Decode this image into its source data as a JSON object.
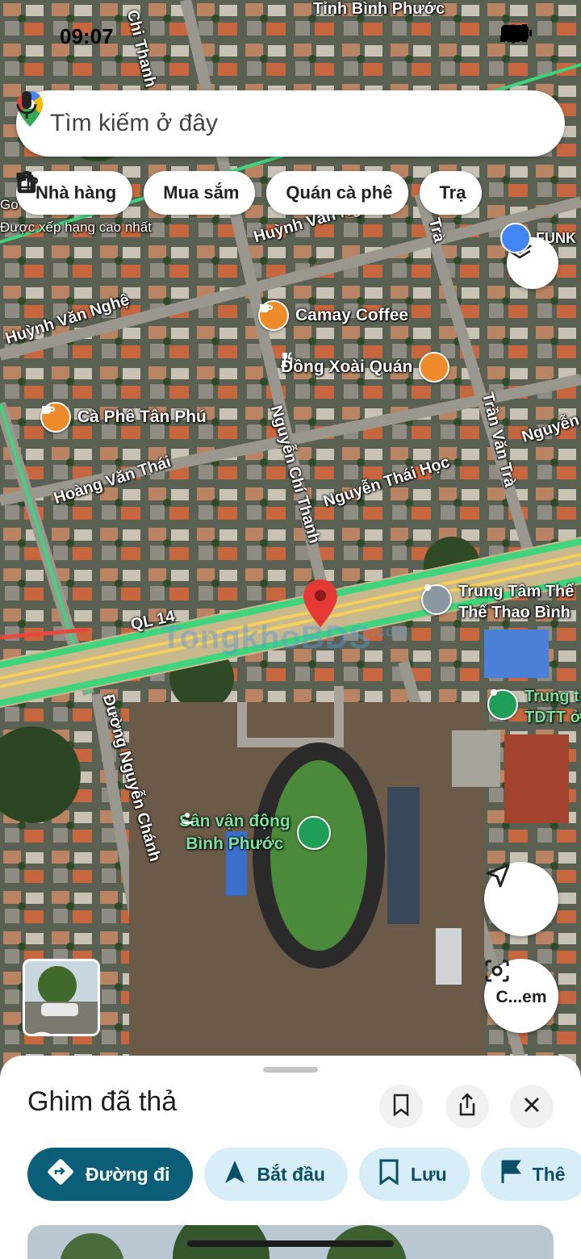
{
  "status_bar": {
    "time": "09:07"
  },
  "search": {
    "placeholder": "Tìm kiếm ở đây"
  },
  "chips": [
    {
      "label": "Nhà hàng",
      "icon": "fork-knife-icon"
    },
    {
      "label": "Mua sắm",
      "icon": "shopping-bag-icon"
    },
    {
      "label": "Quán cà phê",
      "icon": "coffee-cup-icon"
    },
    {
      "label": "Trạ",
      "icon": "gas-station-icon"
    }
  ],
  "map": {
    "top_label": "Tỉnh Bình Phước",
    "rated_label": "Được xếp hạng cao nhất",
    "go_label": "Go",
    "funk_label": "FUNK",
    "roads": {
      "huynh_van_nghe_1": "Huỳnh Văn Nghệ",
      "huynh_van_nghe_2": "Huỳnh Văn Nghệ",
      "nguyen_chi_thanh_top": "Chi Thanh",
      "nguyen_chi_thanh": "Nguyễn Chí Thanh",
      "hoang_van_thai": "Hoàng Văn Thái",
      "nguyen_thai_hoc": "Nguyễn Thái Học",
      "tran_van_tra": "Trần Văn Trà",
      "tran_van_tra_top": "Trà",
      "nguyen_right": "Nguyễn",
      "ql14": "QL 14",
      "duong_nguyen_chanh": "Đường Nguyễn Chánh"
    },
    "pois": {
      "camay": "Camay Coffee",
      "dong_xoai": "Đồng Xoài Quán",
      "ca_phe_tan_phu": "Cà Phê Tân Phú",
      "trung_tam_1": "Trung Tâm Thể",
      "trung_tam_2": "Thể Thao Bình",
      "trung_t_1": "Trung t",
      "trung_t_2": "TDTT ở",
      "san_van_dong_1": "Sân vận động",
      "san_van_dong_2": "Bình Phước"
    },
    "watermark": "TongkhoBDS",
    "watermark_sup": ".com"
  },
  "camera_button": {
    "label": "C...em"
  },
  "sheet": {
    "title": "Ghim đã thả",
    "actions": [
      {
        "label": "Đường đi",
        "icon": "directions-icon"
      },
      {
        "label": "Bắt đầu",
        "icon": "navigation-arrow-icon"
      },
      {
        "label": "Lưu",
        "icon": "bookmark-icon"
      },
      {
        "label": "Thê",
        "icon": "flag-icon"
      }
    ]
  },
  "colors": {
    "accent": "#0b5e78",
    "secondary_btn": "#d7eef8",
    "pin_red": "#e53935",
    "poi_orange": "#f08b2b",
    "poi_green": "#1e9e57",
    "route_yellow": "#f4d05a",
    "traffic_green": "#3fd57d"
  }
}
